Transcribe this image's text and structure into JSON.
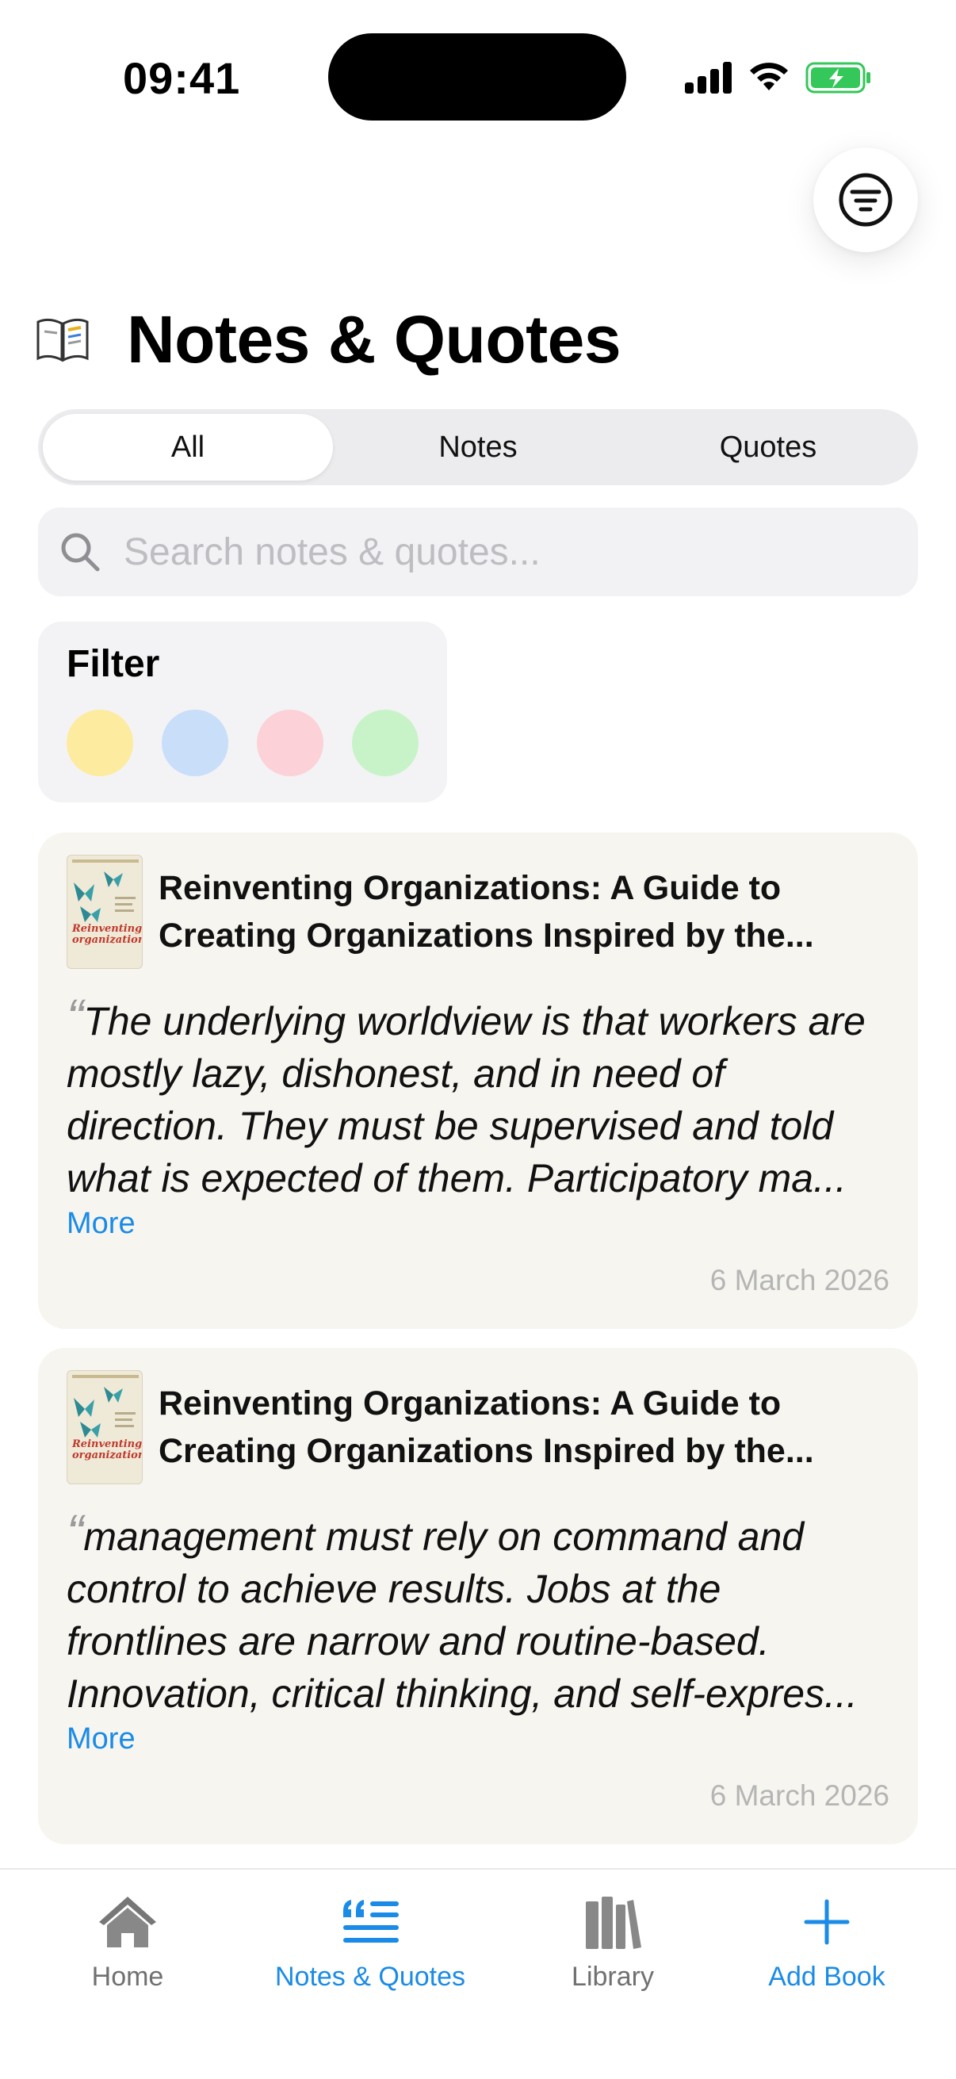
{
  "status_bar": {
    "time": "09:41"
  },
  "header": {
    "title": "Notes & Quotes"
  },
  "segments": [
    {
      "label": "All",
      "active": true
    },
    {
      "label": "Notes",
      "active": false
    },
    {
      "label": "Quotes",
      "active": false
    }
  ],
  "search": {
    "placeholder": "Search notes & quotes..."
  },
  "filter": {
    "label": "Filter",
    "colors": [
      "#fdeba0",
      "#c9def9",
      "#fcd1d8",
      "#c8f3c8"
    ]
  },
  "cards": [
    {
      "book_title": "Reinventing Organizations: A Guide to Creating Organizations Inspired by the...",
      "cover_text": "Reinventing organizations",
      "quote": "The underlying worldview is that workers are mostly lazy, dishonest, and in need of direction. They must be supervised and told what is expected of them. Participatory ma...",
      "more_label": "More",
      "date": "6 March 2026"
    },
    {
      "book_title": "Reinventing Organizations: A Guide to Creating Organizations Inspired by the...",
      "cover_text": "Reinventing organizations",
      "quote": "management must rely on command and control to achieve results. Jobs at the frontlines are narrow and routine-based. Innovation, critical thinking, and self-expres...",
      "more_label": "More",
      "date": "6 March 2026"
    }
  ],
  "tab_bar": {
    "home": "Home",
    "notes": "Notes & Quotes",
    "library": "Library",
    "add_book": "Add Book"
  },
  "colors": {
    "accent": "#1a8be6",
    "card_bg": "#f7f5f0"
  }
}
